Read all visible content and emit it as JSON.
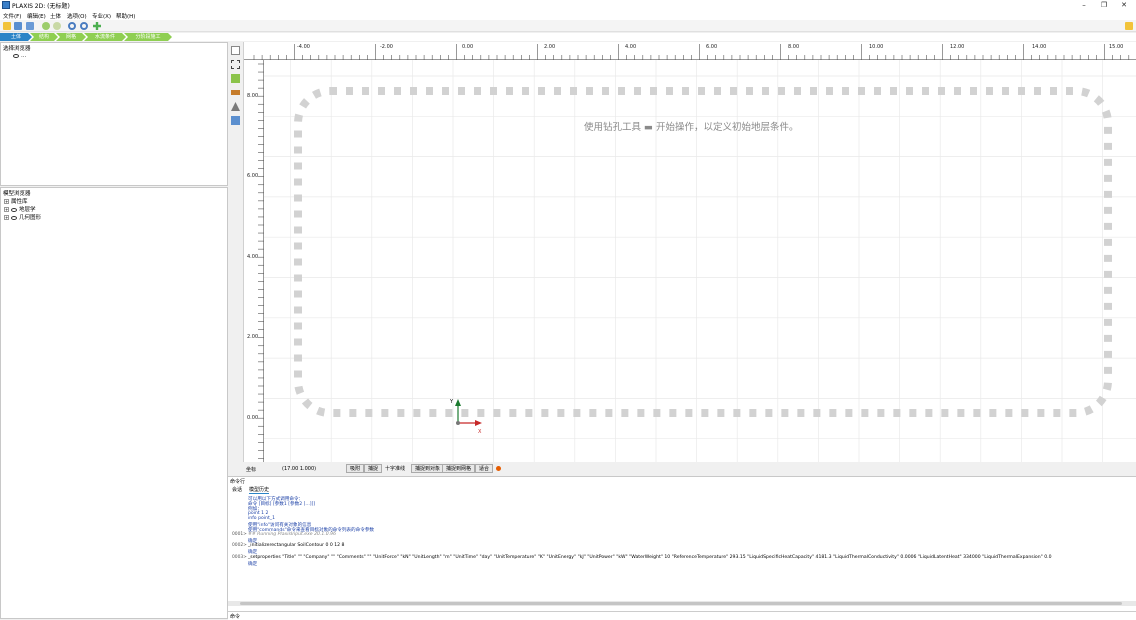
{
  "window": {
    "title": "PLAXIS 2D: (无标题)",
    "controls": [
      "–",
      "❐",
      "✕"
    ]
  },
  "menu": [
    "文件(F)",
    "编辑(E)",
    "土体",
    "选项(O)",
    "专业(X)",
    "帮助(H)"
  ],
  "mode_tabs": [
    "土体",
    "结构",
    "网格",
    "水流条件",
    "分阶段施工"
  ],
  "selection_explorer": {
    "title": "选择浏览器",
    "item": "..."
  },
  "model_explorer": {
    "title": "模型浏览器",
    "items": [
      "属性库",
      "地层学",
      "几何图形"
    ]
  },
  "ruler": {
    "x_labels": [
      "-4.00",
      "-2.00",
      "0.00",
      "2.00",
      "4.00",
      "6.00",
      "8.00",
      "10.00",
      "12.00",
      "14.00",
      "15.00"
    ],
    "y_labels": [
      "8.00",
      "6.00",
      "4.00",
      "2.00",
      "0.00"
    ]
  },
  "canvas": {
    "hint": "使用钻孔工具 ▬ 开始操作，以定义初始地层条件。",
    "axis_x": "X",
    "axis_y": "Y"
  },
  "status": {
    "coord_label": "坐标",
    "coords": "(17.00 1.000)",
    "buttons": [
      "吸附",
      "捕捉",
      "十字准线",
      "捕捉到对象",
      "捕捉到网格",
      "适合"
    ]
  },
  "command": {
    "title": "命令行",
    "tabs": [
      "会话",
      "模型历史"
    ],
    "lines": [
      {
        "n": "",
        "t": "可以用以下方式调用命令：",
        "c": "blue"
      },
      {
        "n": "",
        "t": "    命令 [目标] [参数1 [参数2 [...]]]",
        "c": "blue"
      },
      {
        "n": "",
        "t": "例如：",
        "c": "blue"
      },
      {
        "n": "",
        "t": "    point 1 2",
        "c": "blue"
      },
      {
        "n": "",
        "t": "    info point_1",
        "c": "blue"
      },
      {
        "n": "",
        "t": "使用\"info\"访问有关对象的信息",
        "c": "blue"
      },
      {
        "n": "",
        "t": "使用\"commands\"命令来查看目标对象的命令列表的命令参数",
        "c": "blue"
      },
      {
        "n": "0001>",
        "t": "## Running PlaxisInput.exe 20.1.0.96",
        "c": "gray"
      },
      {
        "n": "",
        "t": "确定",
        "c": "blue"
      },
      {
        "n": "0002>",
        "t": "_initializerectangular SoilContour 0 0 12 8",
        "c": "blk"
      },
      {
        "n": "",
        "t": "确定",
        "c": "blue"
      },
      {
        "n": "0003>",
        "t": "_setproperties \"Title\" \"\" \"Company\" \"\" \"Comments\" \"\" \"UnitForce\" \"kN\" \"UnitLength\" \"m\" \"UnitTime\" \"day\" \"UnitTemperature\" \"K\" \"UnitEnergy\" \"kJ\" \"UnitPower\" \"kW\" \"WaterWeight\" 10 \"ReferenceTemperature\" 293.15 \"LiquidSpecificHeatCapacity\" 4181.3 \"LiquidThermalConductivity\" 0.0006 \"LiquidLatentHeat\" 334000 \"LiquidThermalExpansion\" 0.0",
        "c": "blk"
      },
      {
        "n": "",
        "t": "确定",
        "c": "blue"
      }
    ],
    "input_label": "命令"
  }
}
